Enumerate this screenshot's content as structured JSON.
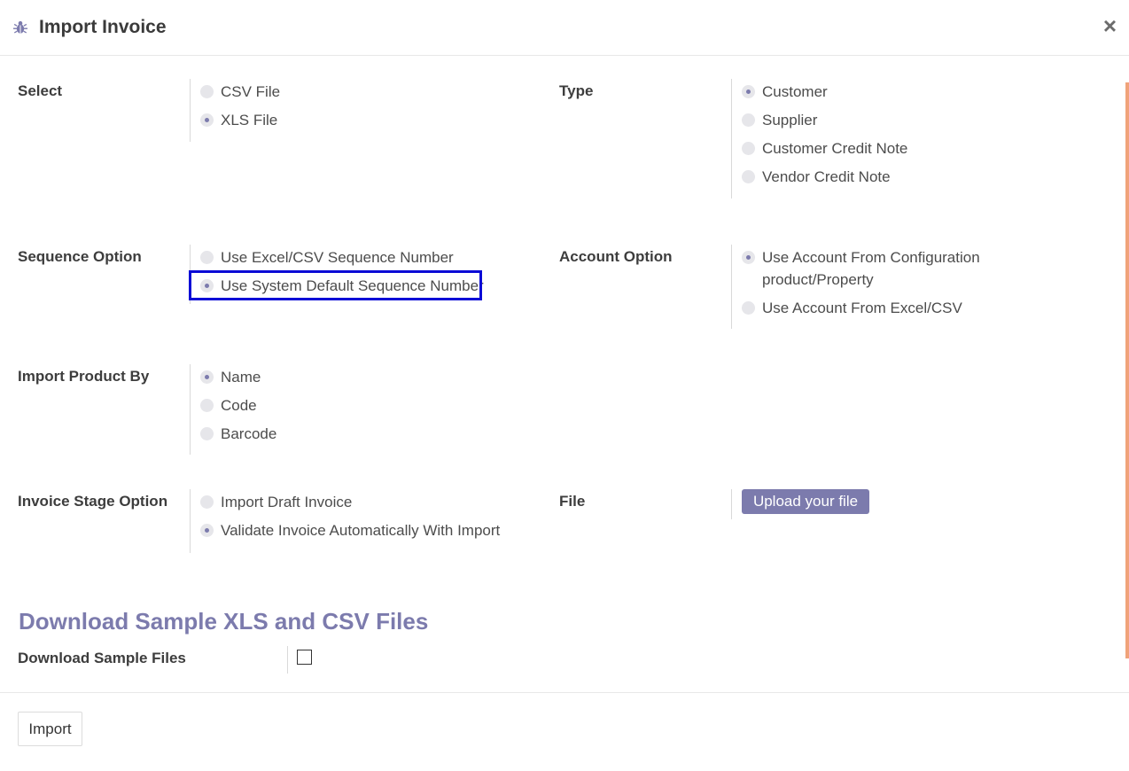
{
  "dialog": {
    "title": "Import Invoice",
    "close_symbol": "×"
  },
  "select": {
    "label": "Select",
    "options": [
      {
        "label": "CSV File",
        "checked": false
      },
      {
        "label": "XLS File",
        "checked": true
      }
    ]
  },
  "type": {
    "label": "Type",
    "options": [
      {
        "label": "Customer",
        "checked": true
      },
      {
        "label": "Supplier",
        "checked": false
      },
      {
        "label": "Customer Credit Note",
        "checked": false
      },
      {
        "label": "Vendor Credit Note",
        "checked": false
      }
    ]
  },
  "sequence": {
    "label": "Sequence Option",
    "options": [
      {
        "label": "Use Excel/CSV Sequence Number",
        "checked": false
      },
      {
        "label": "Use System Default Sequence Number",
        "checked": true
      }
    ]
  },
  "account": {
    "label": "Account Option",
    "options": [
      {
        "label_line1": "Use Account From Configuration",
        "label_line2": "product/Property",
        "checked": true
      },
      {
        "label": "Use Account From Excel/CSV",
        "checked": false
      }
    ]
  },
  "product_by": {
    "label": "Import Product By",
    "options": [
      {
        "label": "Name",
        "checked": true
      },
      {
        "label": "Code",
        "checked": false
      },
      {
        "label": "Barcode",
        "checked": false
      }
    ]
  },
  "stage": {
    "label": "Invoice Stage Option",
    "options": [
      {
        "label": "Import Draft Invoice",
        "checked": false
      },
      {
        "label": "Validate Invoice Automatically With Import",
        "checked": true
      }
    ]
  },
  "file": {
    "label": "File",
    "upload_label": "Upload your file"
  },
  "download": {
    "section_title": "Download Sample XLS and CSV Files",
    "label": "Download Sample Files",
    "checked": false
  },
  "footer": {
    "import_label": "Import"
  },
  "colors": {
    "accent": "#7c7bad",
    "highlight": "#0b0bd6",
    "scrollbar": "#f0a37a"
  }
}
